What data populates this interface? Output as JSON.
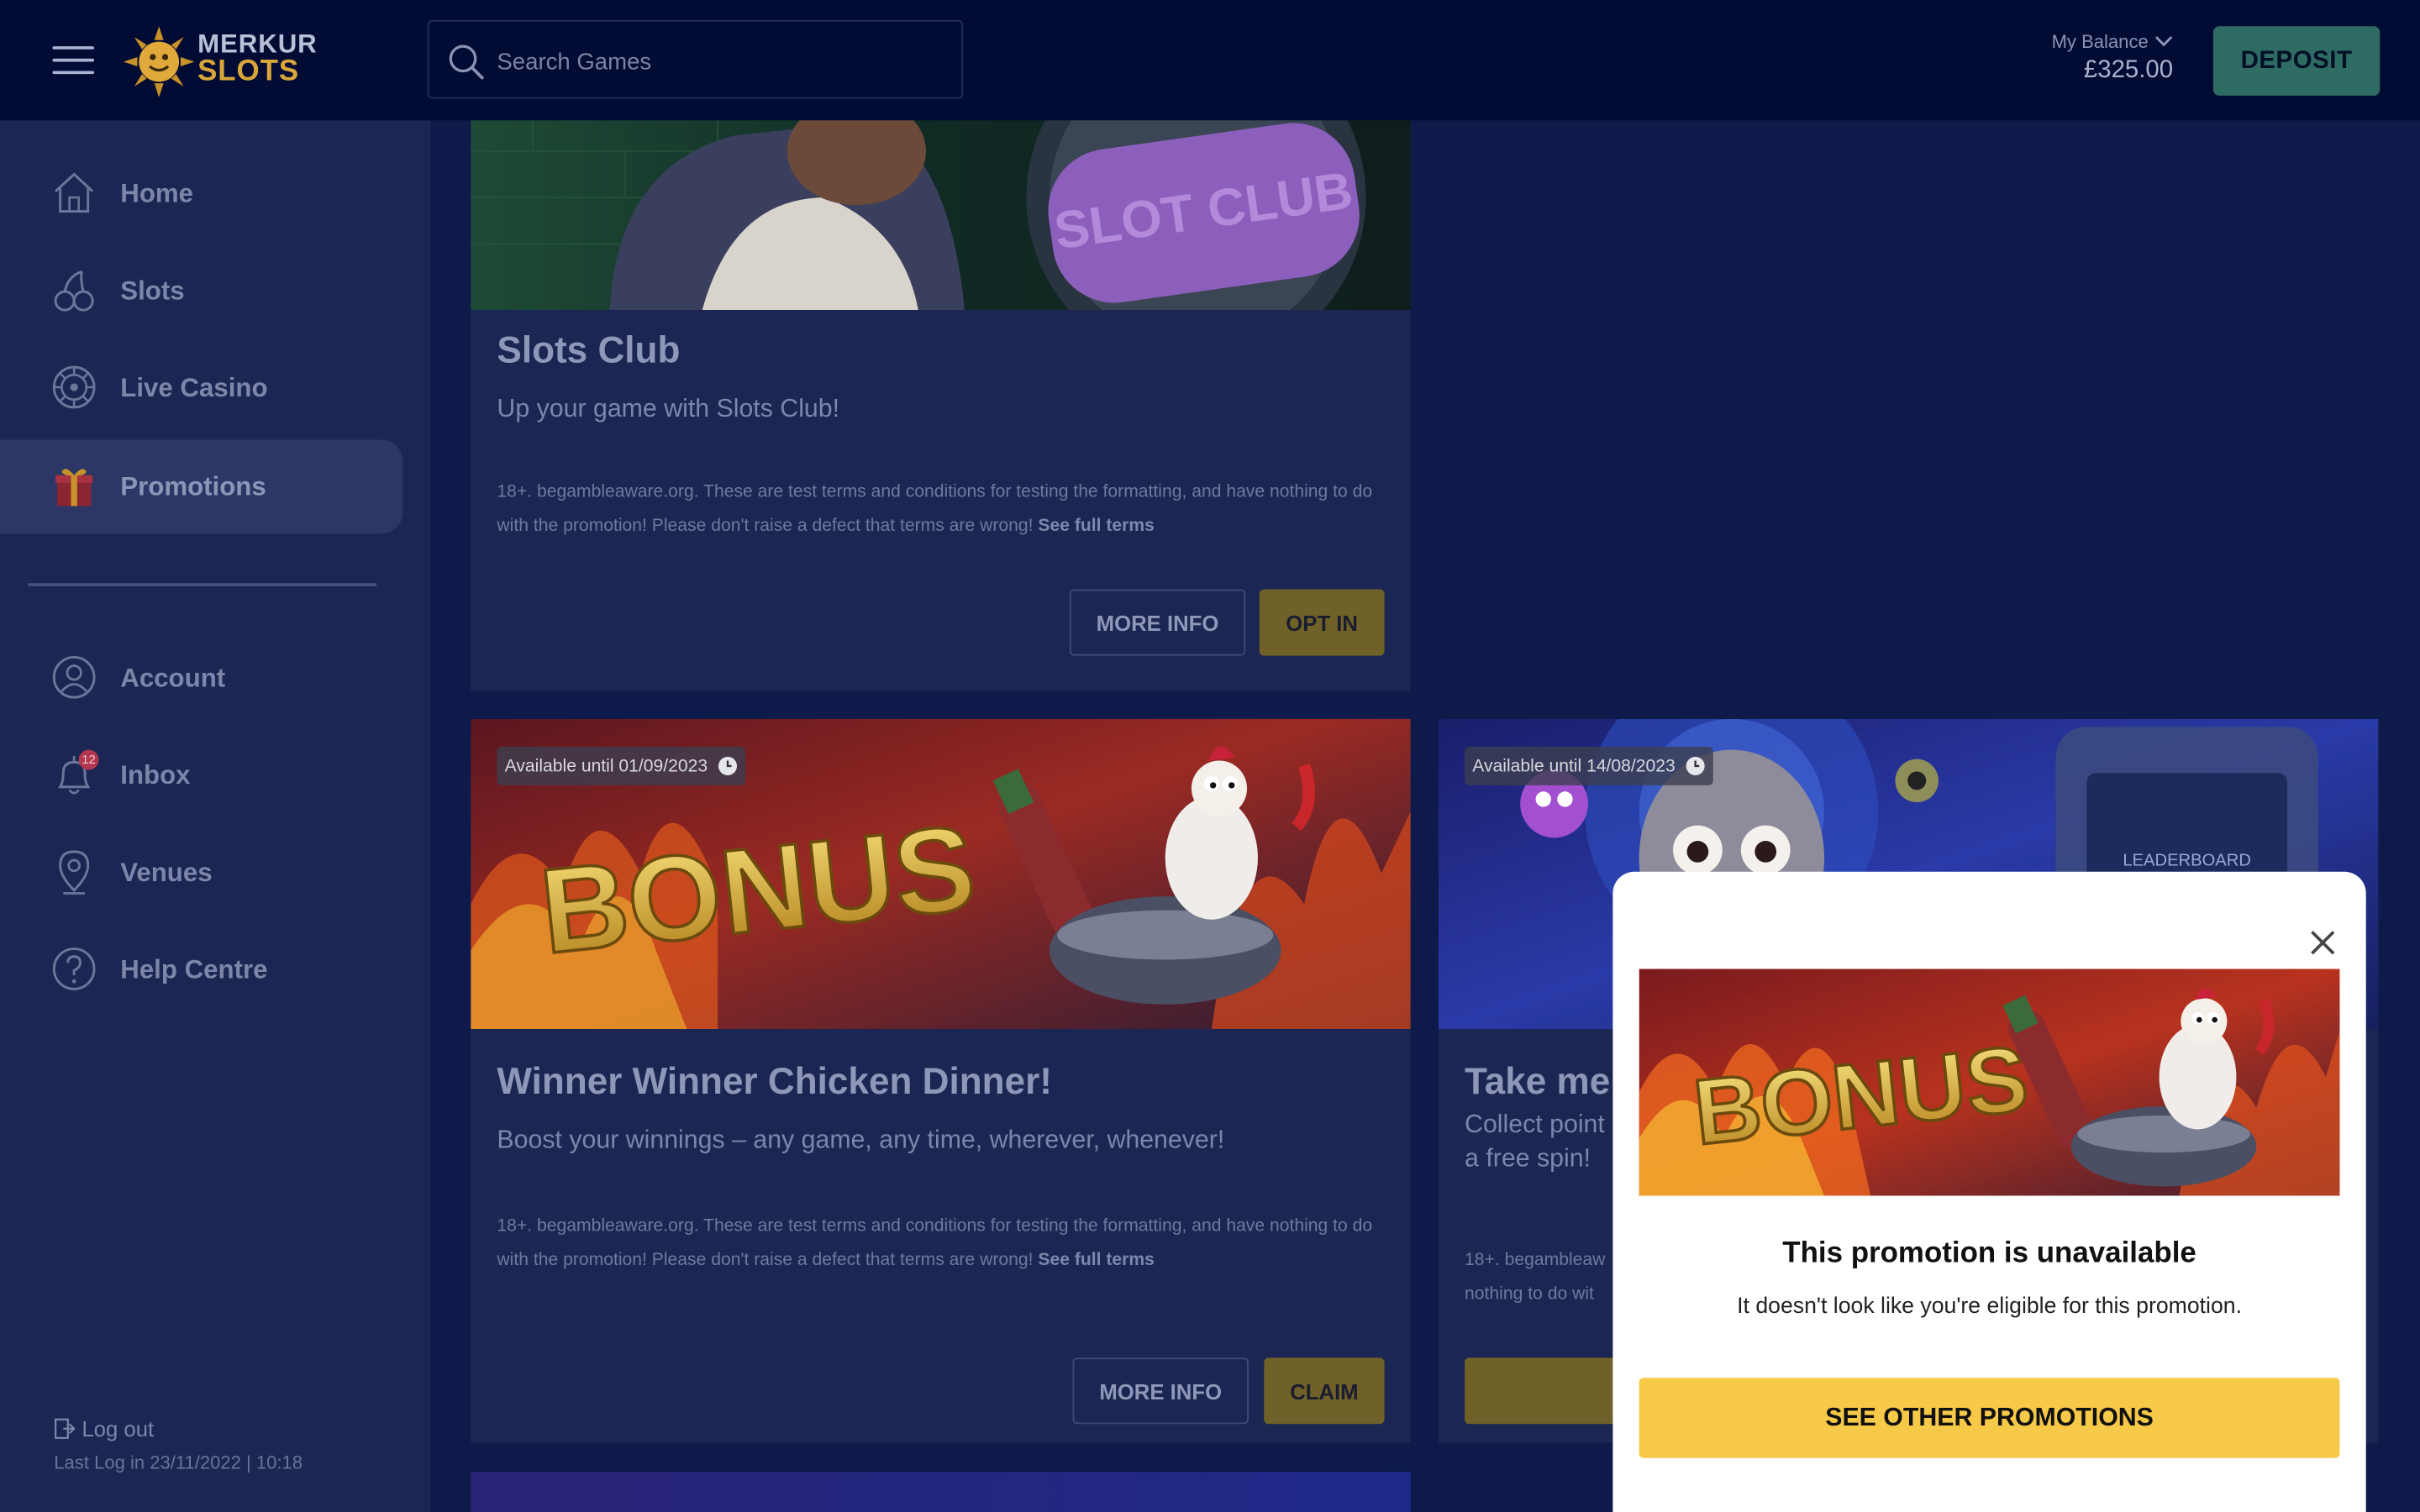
{
  "brand": {
    "line1": "MERKUR",
    "line2": "SLOTS"
  },
  "search": {
    "placeholder": "Search Games"
  },
  "balance": {
    "label": "My Balance",
    "amount": "£325.00"
  },
  "header": {
    "deposit_label": "DEPOSIT"
  },
  "sidebar": {
    "items": [
      {
        "label": "Home",
        "icon": "home-icon"
      },
      {
        "label": "Slots",
        "icon": "cherries-icon"
      },
      {
        "label": "Live Casino",
        "icon": "roulette-icon"
      },
      {
        "label": "Promotions",
        "icon": "gift-icon",
        "active": true
      },
      {
        "label": "Account",
        "icon": "user-icon"
      },
      {
        "label": "Inbox",
        "icon": "bell-icon"
      },
      {
        "label": "Venues",
        "icon": "location-pin-icon"
      },
      {
        "label": "Help Centre",
        "icon": "question-icon"
      }
    ],
    "inbox_count": "12",
    "logout_label": "Log out",
    "last_login": "Last Log in 23/11/2022 | 10:18"
  },
  "promotions": [
    {
      "title": "Slots Club",
      "subtitle": "Up your game with Slots Club!",
      "image_text": "SLOT CLUB",
      "terms": "18+. begambleaware.org. These are test terms and conditions for testing the formatting, and have nothing to do with the promotion! Please don't raise a defect that terms are wrong!",
      "terms_link": "See full terms",
      "more_info_label": "MORE INFO",
      "action_label": "OPT IN"
    },
    {
      "title": "Winner Winner Chicken Dinner!",
      "subtitle": "Boost your winnings – any game, any time, wherever, whenever!",
      "available": "Available until 01/09/2023",
      "image_text": "BONUS",
      "terms": "18+. begambleaware.org. These are test terms and conditions for testing the formatting, and have nothing to do with the promotion! Please don't raise a defect that terms are wrong!",
      "terms_link": "See full terms",
      "more_info_label": "MORE INFO",
      "action_label": "CLAIM"
    },
    {
      "title": "Take me",
      "subtitle_line1": "Collect point",
      "subtitle_line2": "a free spin!",
      "available": "Available until 14/08/2023",
      "image_text": "LEADERBOARD",
      "terms_line1": "18+. begambleaw",
      "terms_line2": "nothing to do wit"
    }
  ],
  "modal": {
    "image_text": "BONUS",
    "title": "This promotion is unavailable",
    "message": "It doesn't look like you're eligible for this promotion.",
    "cta_label": "SEE OTHER PROMOTIONS"
  },
  "colors": {
    "topbar": "#020b33",
    "sidebar": "#1c2653",
    "deposit": "#2e6b63",
    "gold_button": "#6f6128",
    "cta": "#f7c948"
  }
}
